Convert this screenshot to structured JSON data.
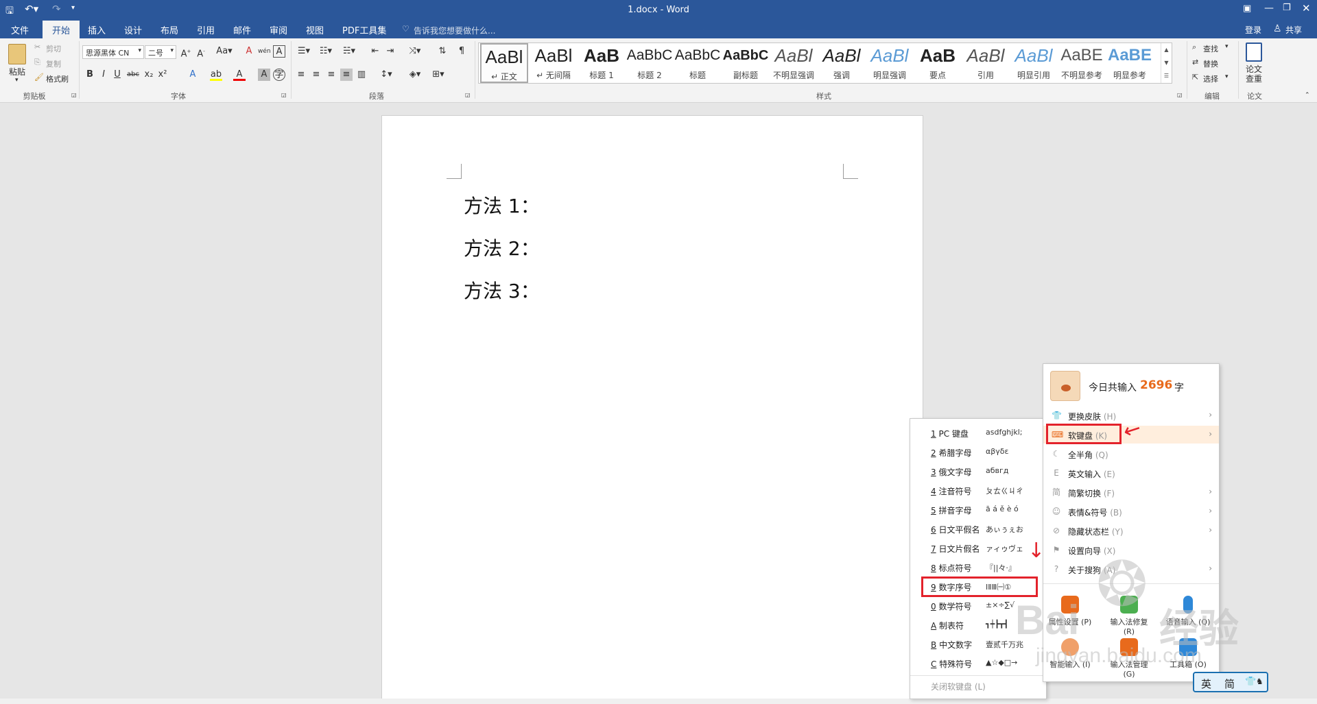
{
  "window": {
    "title": "1.docx - Word"
  },
  "tabs": [
    "文件",
    "开始",
    "插入",
    "设计",
    "布局",
    "引用",
    "邮件",
    "审阅",
    "视图",
    "PDF工具集"
  ],
  "tell_me": "告诉我您想要做什么...",
  "account": {
    "login": "登录",
    "share": "共享"
  },
  "ribbon": {
    "clipboard": {
      "paste": "粘贴",
      "cut": "剪切",
      "copy": "复制",
      "format_painter": "格式刷",
      "group": "剪贴板"
    },
    "font": {
      "name": "思源黑体 CN",
      "size": "二号",
      "group": "字体"
    },
    "paragraph": {
      "group": "段落"
    },
    "styles": {
      "group": "样式",
      "items": [
        {
          "sample": "AaBl",
          "label": "↵ 正文"
        },
        {
          "sample": "AaBl",
          "label": "↵ 无间隔"
        },
        {
          "sample": "AaB",
          "label": "标题 1"
        },
        {
          "sample": "AaBbC",
          "label": "标题 2"
        },
        {
          "sample": "AaBbC",
          "label": "标题"
        },
        {
          "sample": "AaBbC",
          "label": "副标题"
        },
        {
          "sample": "AaBl",
          "label": "不明显强调"
        },
        {
          "sample": "AaBl",
          "label": "强调"
        },
        {
          "sample": "AaBl",
          "label": "明显强调"
        },
        {
          "sample": "AaB",
          "label": "要点"
        },
        {
          "sample": "AaBl",
          "label": "引用"
        },
        {
          "sample": "AaBl",
          "label": "明显引用"
        },
        {
          "sample": "AaBE",
          "label": "不明显参考"
        },
        {
          "sample": "AaBE",
          "label": "明显参考"
        }
      ]
    },
    "editing": {
      "find": "查找",
      "replace": "替换",
      "select": "选择",
      "group": "编辑"
    },
    "paper": {
      "check": "论文查重",
      "group": "论文"
    }
  },
  "document": {
    "paragraphs": [
      "方法 1：",
      "方法 2：",
      "方法 3："
    ]
  },
  "sogou_menu": {
    "stats_prefix": "今日共输入",
    "stats_count": "2696",
    "stats_suffix": "字",
    "items": [
      {
        "label": "更换皮肤",
        "key": "(H)"
      },
      {
        "label": "软键盘",
        "key": "(K)"
      },
      {
        "label": "全半角",
        "key": "(Q)"
      },
      {
        "label": "英文输入",
        "key": "(E)"
      },
      {
        "label": "简繁切换",
        "key": "(F)"
      },
      {
        "label": "表情&符号",
        "key": "(B)"
      },
      {
        "label": "隐藏状态栏",
        "key": "(Y)"
      },
      {
        "label": "设置向导",
        "key": "(X)"
      },
      {
        "label": "关于搜狗",
        "key": "(A)"
      }
    ],
    "bottom": [
      "属性设置 (P)",
      "输入法修复 (R)",
      "语音输入 (Q)",
      "智能输入 (I)",
      "输入法管理 (G)",
      "工具箱 (O)"
    ]
  },
  "soft_keyboard_menu": {
    "items": [
      {
        "key": "1",
        "label": "PC 键盘",
        "sample": "asdfghjkl;"
      },
      {
        "key": "2",
        "label": "希腊字母",
        "sample": "αβγδε"
      },
      {
        "key": "3",
        "label": "俄文字母",
        "sample": "абвгд"
      },
      {
        "key": "4",
        "label": "注音符号",
        "sample": "ㄆㄊㄍㄐㄔ"
      },
      {
        "key": "5",
        "label": "拼音字母",
        "sample": "ā á ě è ó"
      },
      {
        "key": "6",
        "label": "日文平假名",
        "sample": "あぃぅぇお"
      },
      {
        "key": "7",
        "label": "日文片假名",
        "sample": "ァィゥヴェ"
      },
      {
        "key": "8",
        "label": "标点符号",
        "sample": "『||々·』"
      },
      {
        "key": "9",
        "label": "数字序号",
        "sample": "ⅠⅡⅢ㈠①"
      },
      {
        "key": "0",
        "label": "数学符号",
        "sample": "±×÷∑√"
      },
      {
        "key": "A",
        "label": "制表符",
        "sample": "┓┿┣┳┫"
      },
      {
        "key": "B",
        "label": "中文数字",
        "sample": "壹贰千万兆"
      },
      {
        "key": "C",
        "label": "特殊符号",
        "sample": "▲☆◆□→"
      }
    ],
    "close": "关闭软键盘 (L)"
  },
  "ime_bar": {
    "mode": "英",
    "script": "简"
  },
  "watermark": {
    "brand": "Bai",
    "brand2": "经验",
    "url": "jingyan.baidu.com"
  },
  "colors": {
    "accent": "#2b579a",
    "highlight": "#e3222b",
    "count": "#e86a1c"
  }
}
